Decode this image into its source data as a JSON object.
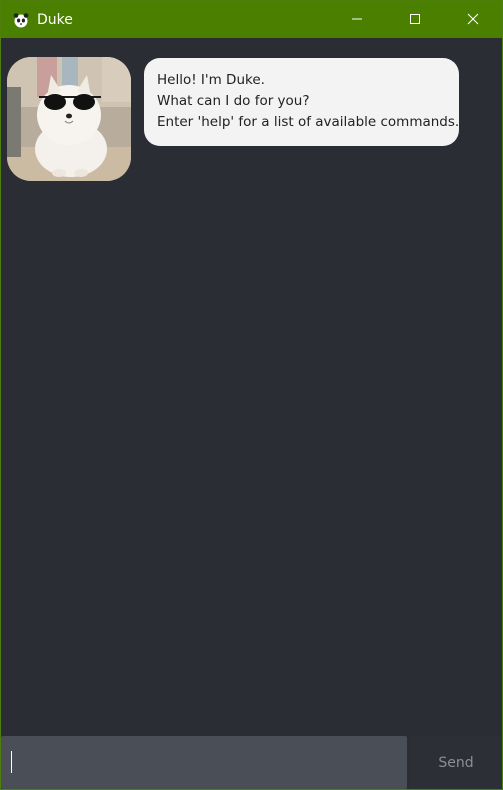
{
  "window": {
    "title": "Duke",
    "app_icon": "panda-icon",
    "controls": [
      "minimize-icon",
      "maximize-icon",
      "close-icon"
    ]
  },
  "colors": {
    "titlebar": "#4a7f00",
    "background": "#2a2d33",
    "bubble": "#f3f3f3",
    "input": "#4a4e57"
  },
  "chat": {
    "messages": [
      {
        "sender": "duke",
        "avatar": "dog-with-sunglasses-avatar",
        "lines": [
          "Hello! I'm Duke.",
          "What can I do for you?",
          "Enter 'help' for a list of available commands."
        ]
      }
    ]
  },
  "input": {
    "value": "",
    "send_label": "Send"
  }
}
